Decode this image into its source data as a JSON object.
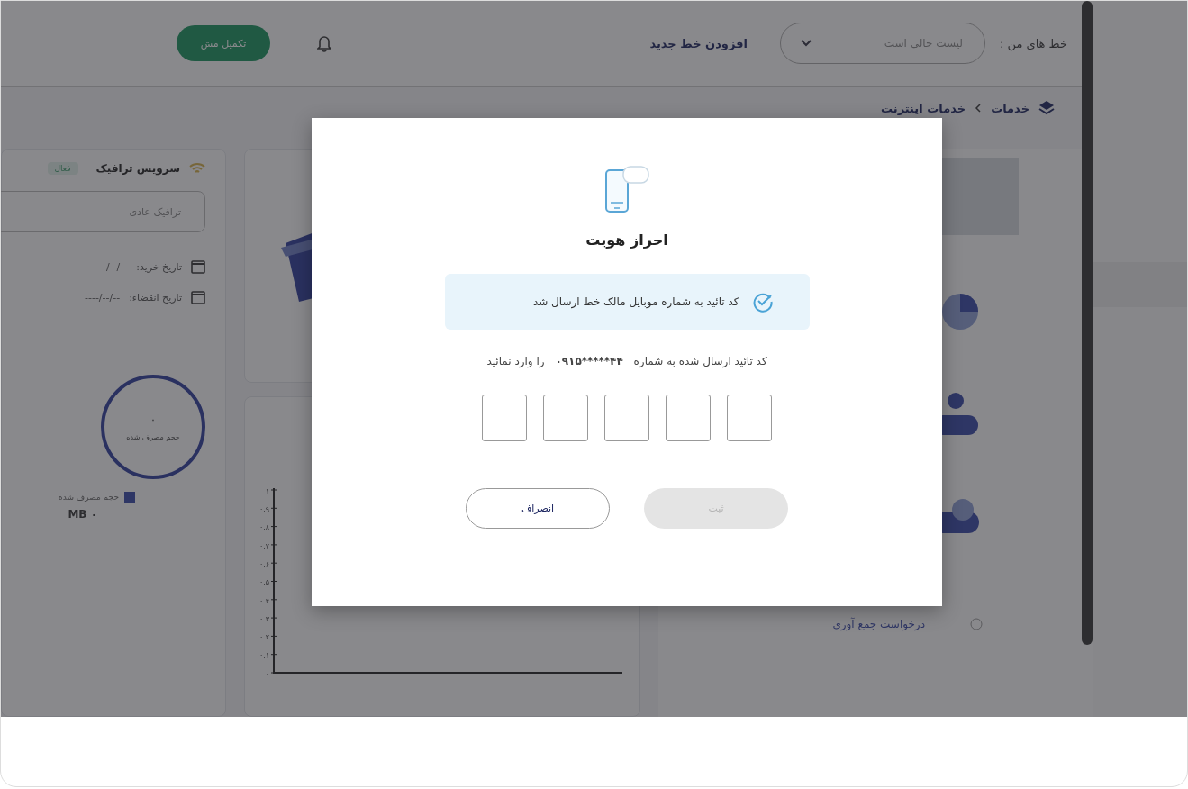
{
  "header": {
    "lines_label": "خط های من :",
    "lines_dropdown": {
      "value": "لیست خالی است"
    },
    "add_line_link": "افزودن خط جدید",
    "complete_button": "تکمیل مش"
  },
  "breadcrumb": [
    "خدمات",
    "خدمات اینترنت"
  ],
  "traffic_card": {
    "title": "سرویس ترافیک",
    "status": "فعال",
    "traffic_select": {
      "value": "ترافیک عادی"
    },
    "dates": [
      {
        "label": "تاریخ خرید:",
        "value": "--/--/----"
      },
      {
        "label": "تاریخ انقضاء:",
        "value": "--/--/----"
      }
    ],
    "gauge": {
      "value": "۰",
      "label": "حجم مصرف شده"
    },
    "legend": "حجم مصرف شده",
    "total": "۰ MB"
  },
  "chart_axis": {
    "ticks": [
      "۱",
      "۰.۹",
      "۰.۸",
      "۰.۷",
      "۰.۶",
      "۰.۵",
      "۰.۴",
      "۰.۳",
      "۰.۲",
      "۰.۱",
      "۰"
    ]
  },
  "services": {
    "request_title": "درخواست جمع آوری"
  },
  "modal": {
    "title": "احراز هویت",
    "alert": "کد تائید به شماره موبایل مالک خط ارسال شد",
    "instruction": {
      "before": "کد تائید ارسال شده به شماره",
      "phone": "۰۹۱۵*****۴۴",
      "after": "را وارد نمائید"
    },
    "buttons": [
      {
        "label": "ثبت",
        "kind": "primary",
        "disabled": true
      },
      {
        "label": "انصراف",
        "kind": "secondary",
        "disabled": false
      }
    ]
  }
}
